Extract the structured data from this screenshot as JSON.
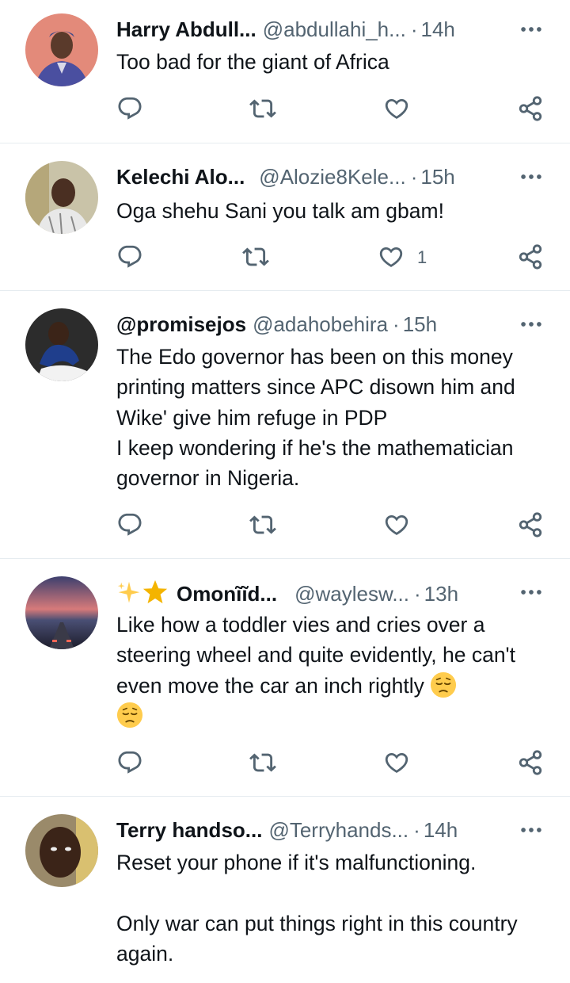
{
  "tweets": [
    {
      "name": "Harry Abdull...",
      "handle": "@abdullahi_h...",
      "dot": "·",
      "time": "14h",
      "text": "Too bad for the giant of Africa",
      "likes": ""
    },
    {
      "name": "Kelechi Alo...",
      "handle": "@Alozie8Kele...",
      "dot": "·",
      "time": "15h",
      "text": "Oga shehu Sani you talk am gbam!",
      "likes": "1"
    },
    {
      "name": "@promisejos",
      "handle": "@adahobehira",
      "dot": "·",
      "time": "15h",
      "text": "The Edo governor has been on this money printing matters since APC disown him and Wike' give him refuge in PDP\nI keep wondering if he's the mathematician governor in Nigeria.",
      "likes": ""
    },
    {
      "name_emoji": [
        "sparkles",
        "star"
      ],
      "name": "Omonĩĩd...",
      "handle": "@waylesw...",
      "dot": "·",
      "time": "13h",
      "text": "Like how a toddler vies and cries over a steering wheel and quite evidently, he can't even move the car an inch rightly",
      "text_emoji": [
        "pensive-face",
        "pensive-face"
      ],
      "likes": ""
    },
    {
      "name": "Terry handso...",
      "handle": "@Terryhands...",
      "dot": "·",
      "time": "14h",
      "text": "Reset your phone if it's malfunctioning.\n\nOnly war can put things right in this country again.",
      "likes": ""
    }
  ],
  "icons": {
    "reply": "reply-icon",
    "retweet": "retweet-icon",
    "like": "heart-icon",
    "share": "share-icon",
    "more": "more-icon"
  },
  "colors": {
    "text": "#0f1419",
    "secondary": "#536471",
    "divider": "#e6ecf0",
    "star": "#f4b400"
  }
}
